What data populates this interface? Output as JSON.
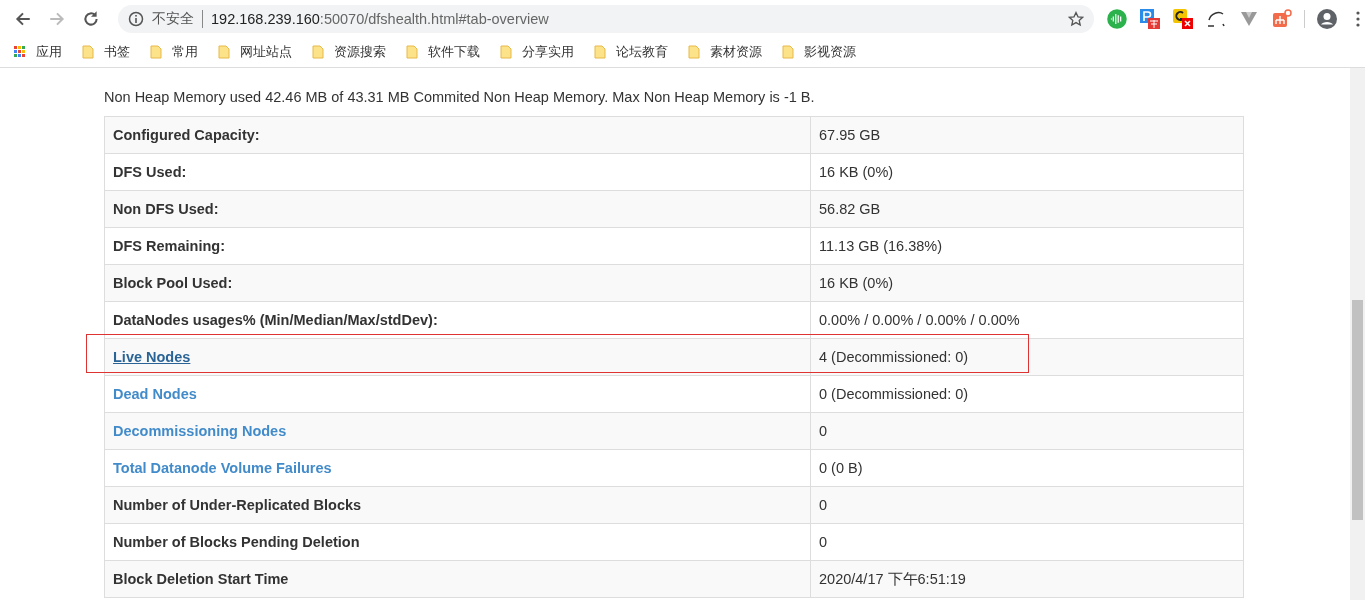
{
  "browser": {
    "security_label": "不安全",
    "url_host": "192.168.239.160",
    "url_rest": ":50070/dfshealth.html#tab-overview"
  },
  "bookmarks": [
    {
      "label": "应用",
      "kind": "apps"
    },
    {
      "label": "书签",
      "kind": "folder"
    },
    {
      "label": "常用",
      "kind": "folder"
    },
    {
      "label": "网址站点",
      "kind": "folder"
    },
    {
      "label": "资源搜索",
      "kind": "folder"
    },
    {
      "label": "软件下载",
      "kind": "folder"
    },
    {
      "label": "分享实用",
      "kind": "folder"
    },
    {
      "label": "论坛教育",
      "kind": "folder"
    },
    {
      "label": "素材资源",
      "kind": "folder"
    },
    {
      "label": "影视资源",
      "kind": "folder"
    }
  ],
  "memory_text": "Non Heap Memory used 42.46 MB of 43.31 MB Commited Non Heap Memory. Max Non Heap Memory is -1 B.",
  "summary_table": [
    {
      "label": "Configured Capacity:",
      "value": "67.95 GB",
      "kind": "text",
      "highlighted": false
    },
    {
      "label": "DFS Used:",
      "value": "16 KB (0%)",
      "kind": "text",
      "highlighted": false
    },
    {
      "label": "Non DFS Used:",
      "value": "56.82 GB",
      "kind": "text",
      "highlighted": false
    },
    {
      "label": "DFS Remaining:",
      "value": "11.13 GB (16.38%)",
      "kind": "text",
      "highlighted": false
    },
    {
      "label": "Block Pool Used:",
      "value": "16 KB (0%)",
      "kind": "text",
      "highlighted": false
    },
    {
      "label": "DataNodes usages% (Min/Median/Max/stdDev):",
      "value": "0.00% / 0.00% / 0.00% / 0.00%",
      "kind": "text",
      "highlighted": false
    },
    {
      "label": "Live Nodes",
      "value": "4 (Decommissioned: 0)",
      "kind": "link",
      "highlighted": true
    },
    {
      "label": "Dead Nodes",
      "value": "0 (Decommissioned: 0)",
      "kind": "link",
      "highlighted": false
    },
    {
      "label": "Decommissioning Nodes",
      "value": "0",
      "kind": "link",
      "highlighted": false
    },
    {
      "label": "Total Datanode Volume Failures",
      "value": "0 (0 B)",
      "kind": "link",
      "highlighted": false
    },
    {
      "label": "Number of Under-Replicated Blocks",
      "value": "0",
      "kind": "text",
      "highlighted": false
    },
    {
      "label": "Number of Blocks Pending Deletion",
      "value": "0",
      "kind": "text",
      "highlighted": false
    },
    {
      "label": "Block Deletion Start Time",
      "value": "2020/4/17 下午6:51:19",
      "kind": "text",
      "highlighted": false
    }
  ]
}
